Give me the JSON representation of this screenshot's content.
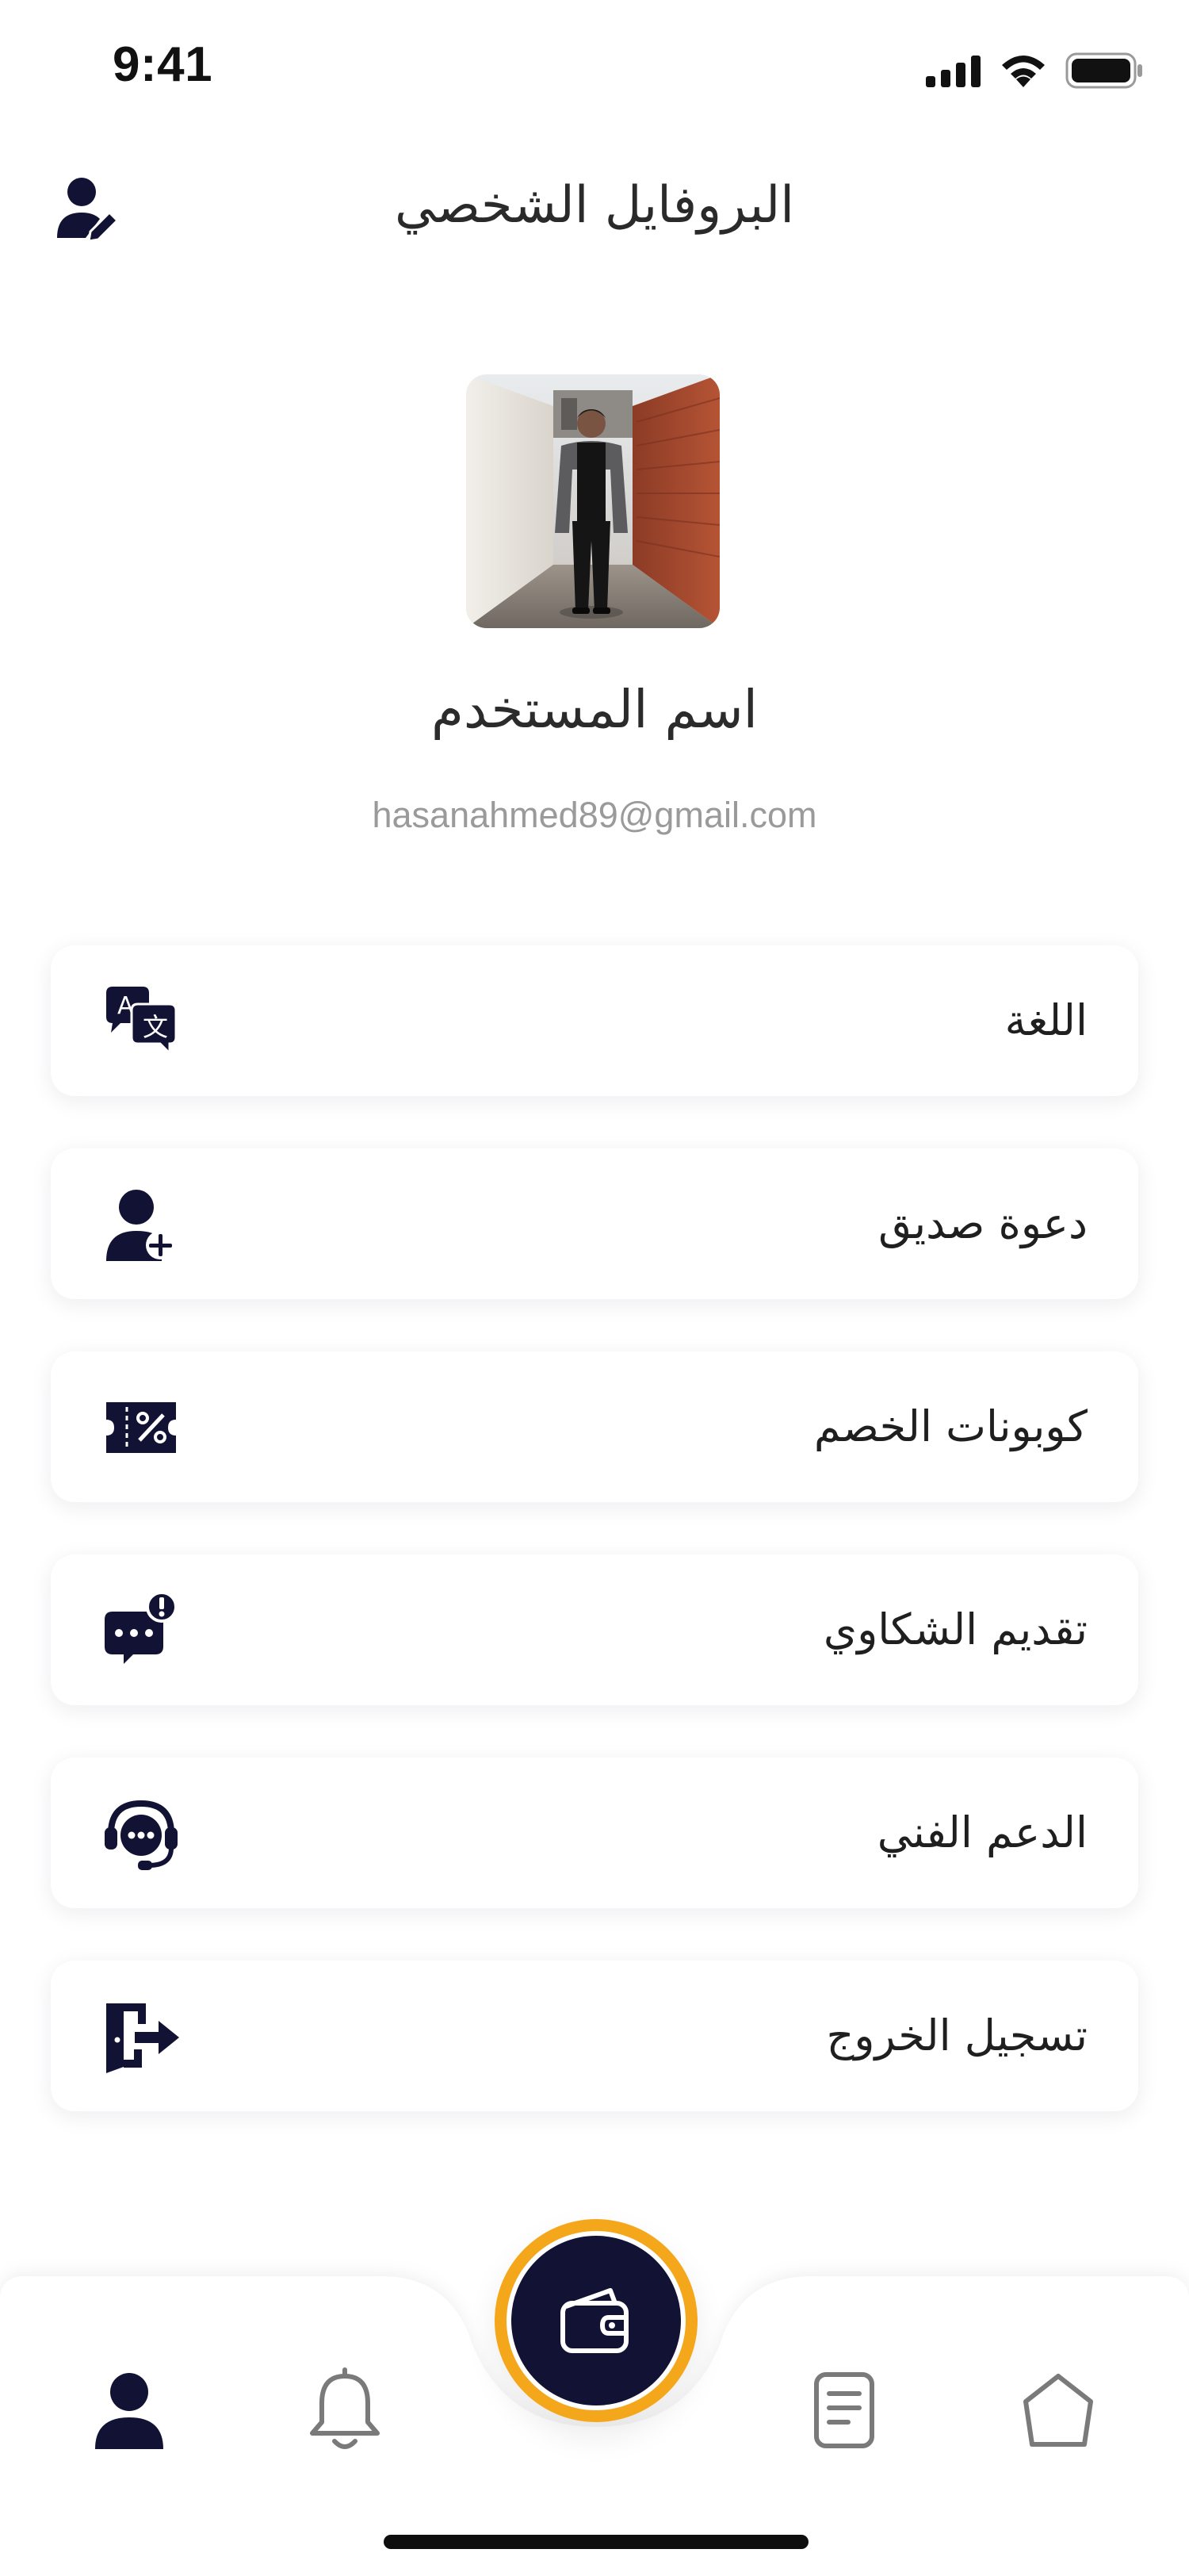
{
  "status_bar": {
    "time": "9:41"
  },
  "header": {
    "title": "البروفايل الشخصي",
    "edit_icon": "user-edit-icon"
  },
  "profile": {
    "name": "اسم المستخدم",
    "email": "hasanahmed89@gmail.com"
  },
  "menu": [
    {
      "label": "اللغة",
      "icon": "language-translate-icon"
    },
    {
      "label": "دعوة صديق",
      "icon": "user-add-icon"
    },
    {
      "label": "كوبونات الخصم",
      "icon": "discount-coupon-icon"
    },
    {
      "label": "تقديم الشكاوي",
      "icon": "complaint-chat-icon"
    },
    {
      "label": "الدعم الفني",
      "icon": "support-headset-icon"
    },
    {
      "label": "تسجيل الخروج",
      "icon": "logout-icon"
    }
  ],
  "bottom_nav": {
    "items": [
      "profile-icon",
      "bell-icon",
      "wallet-icon",
      "document-icon",
      "home-icon"
    ],
    "active": "profile-icon"
  },
  "colors": {
    "primary": "#121235",
    "accent": "#F5A71B",
    "text": "#1F1F1F",
    "muted": "#9A9A9A"
  }
}
